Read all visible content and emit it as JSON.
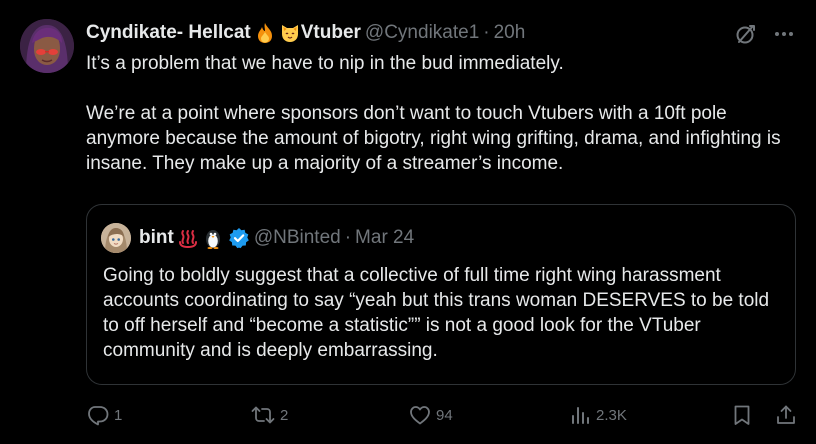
{
  "post": {
    "author": {
      "display_name": "Cyndikate- Hellcat",
      "name_emojis": [
        "fire-emoji",
        "cat-emoji"
      ],
      "name_suffix": "Vtuber",
      "handle": "@Cyndikate1",
      "separator": "·",
      "time": "20h"
    },
    "text_paragraphs": [
      "It’s a problem that we have to nip in the bud immediately.",
      "We’re at a point where sponsors don’t want to touch Vtubers with a 10ft pole anymore because the amount of bigotry, right wing grifting, drama, and infighting is insane. They make up a majority of a  streamer’s income."
    ],
    "top_icons": [
      "grok-icon",
      "more-icon"
    ]
  },
  "quote": {
    "display_name": "bint",
    "name_emojis": [
      "hot-springs-emoji",
      "penguin-emoji"
    ],
    "verified": true,
    "handle": "@NBinted",
    "separator": "·",
    "date": "Mar 24",
    "text": "Going to boldly suggest that a collective of full time right wing harassment accounts coordinating to say “yeah but this trans woman DESERVES to be told to off herself and “become a statistic”” is not a good look for the VTuber community and is deeply embarrassing."
  },
  "actions": {
    "replies": "1",
    "reposts": "2",
    "likes": "94",
    "views": "2.3K"
  },
  "colors": {
    "background": "#000000",
    "text_primary": "#e7e9ea",
    "text_secondary": "#71767b",
    "border": "#2f3336",
    "verified": "#1d9bf0"
  }
}
